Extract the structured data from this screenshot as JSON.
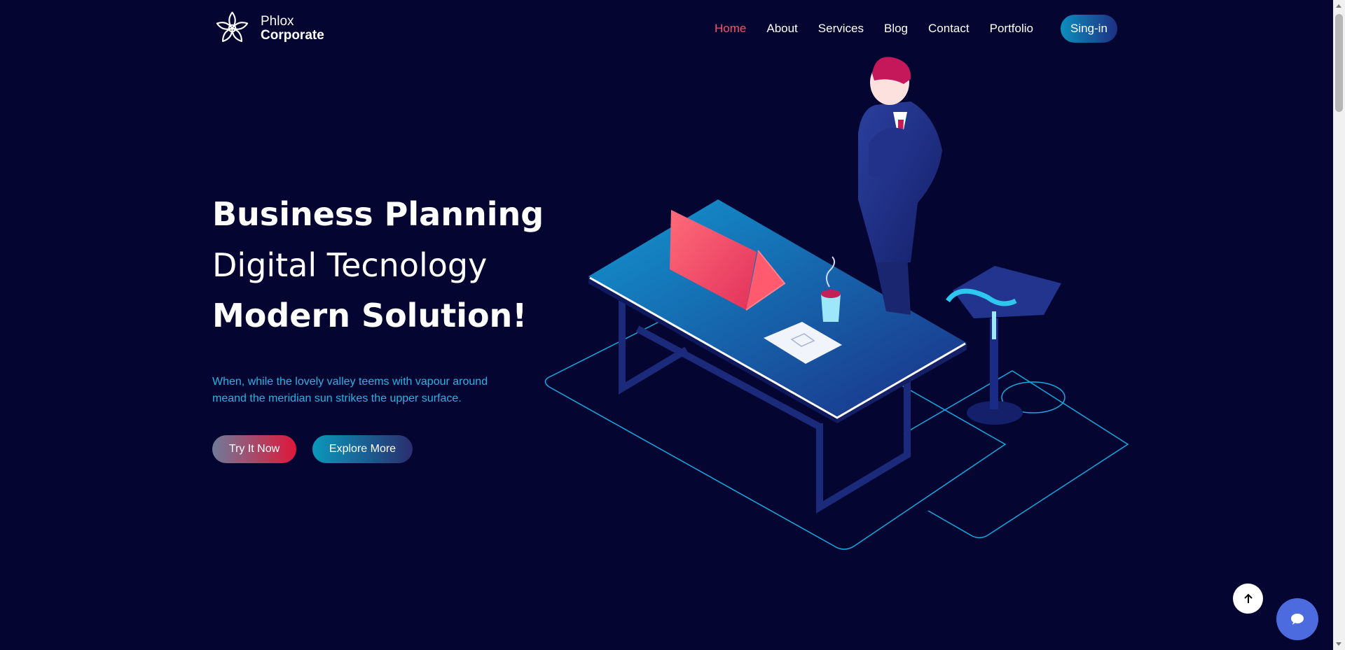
{
  "brand": {
    "line1": "Phlox",
    "line2": "Corporate",
    "logo_icon": "lotus-flower-icon"
  },
  "nav": {
    "items": [
      {
        "label": "Home",
        "active": true
      },
      {
        "label": "About",
        "active": false
      },
      {
        "label": "Services",
        "active": false
      },
      {
        "label": "Blog",
        "active": false
      },
      {
        "label": "Contact",
        "active": false
      },
      {
        "label": "Portfolio",
        "active": false
      }
    ],
    "signin_label": "Sing-in"
  },
  "hero": {
    "line1": "Business Planning",
    "line2": "Digital Tecnology",
    "line3": "Modern Solution!",
    "description": "When, while the lovely valley teems with vapour around meand the meridian sun strikes the upper surface.",
    "primary_button": "Try It Now",
    "secondary_button": "Explore More"
  },
  "floating": {
    "back_to_top_icon": "arrow-up-icon",
    "chat_icon": "chat-bubble-icon"
  },
  "colors": {
    "background": "#040631",
    "accent_active": "#f5516b",
    "description_text": "#2ab1e6",
    "chat_button": "#4c6bdf"
  }
}
